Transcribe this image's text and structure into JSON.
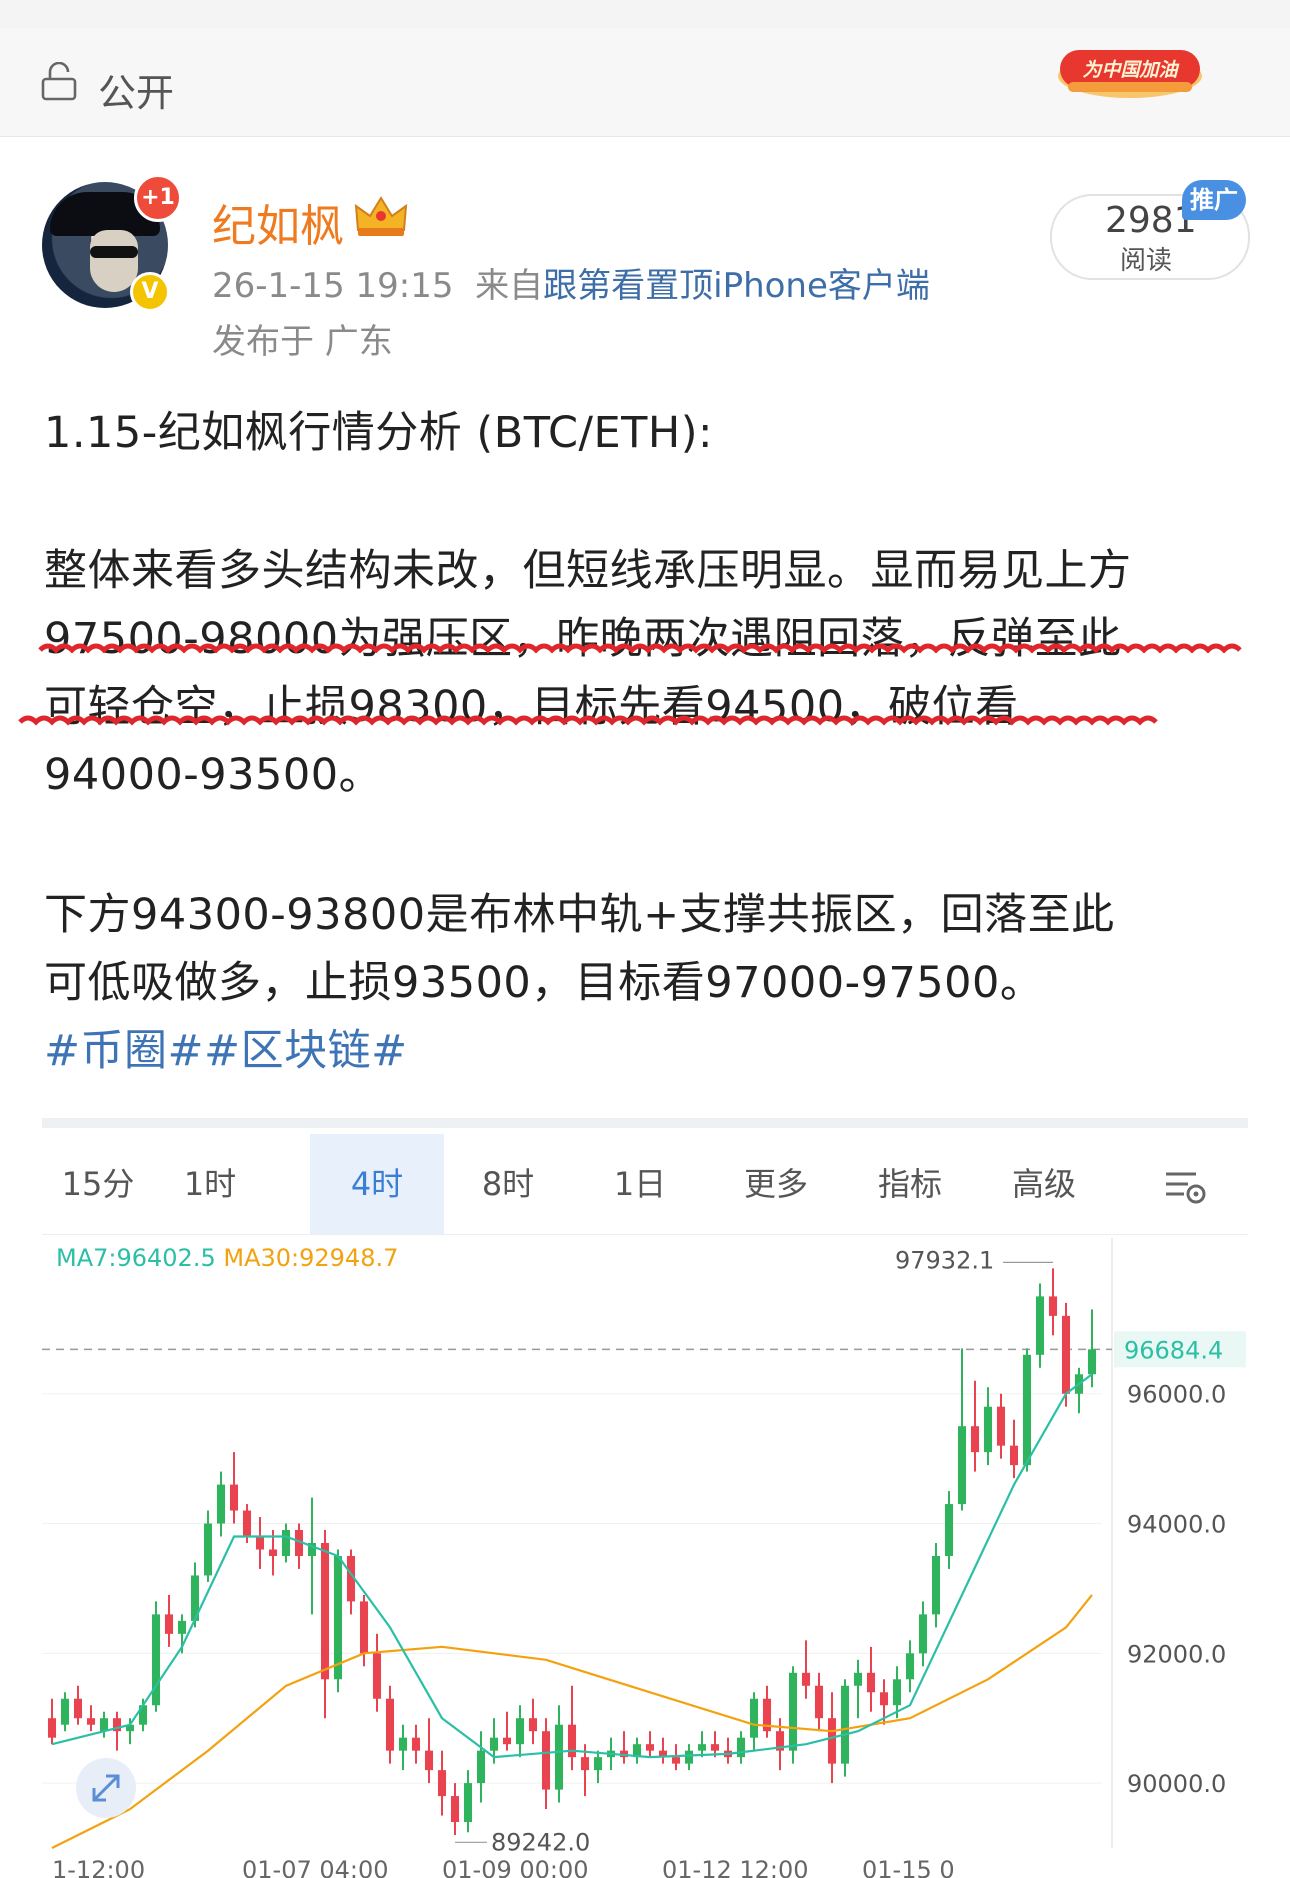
{
  "visibility": {
    "label": "公开",
    "icon": "lock-open-icon"
  },
  "event_badge": {
    "text": "为中国加油"
  },
  "post": {
    "avatar_badge": "+1",
    "verify_badge": "V",
    "username": "纪如枫",
    "time": "26-1-15 19:15",
    "from_prefix": "来自",
    "source": "跟第看置顶iPhone客户端",
    "location": "发布于 广东",
    "reads": "2981",
    "reads_label": "阅读",
    "promo": "推广",
    "title": "1.15-纪如枫行情分析 (BTC/ETH):",
    "p1_l1": "整体来看多头结构未改，但短线承压明显。显而易见上方",
    "p1_l2": "97500-98000为强压区，昨晚两次遇阻回落，反弹至此",
    "p1_l3": "可轻仓空，止损98300，目标先看94500，破位看",
    "p1_l4": "94000-93500。",
    "p2_l1": "下方94300-93800是布林中轨+支撑共振区，回落至此",
    "p2_l2": "可低吸做多，止损93500，目标看97000-97500。",
    "tags": "#币圈##区块链#"
  },
  "chart_tabs": [
    "15分",
    "1时",
    "4时",
    "8时",
    "1日",
    "更多",
    "指标",
    "高级"
  ],
  "chart_active_tab": "4时",
  "indicators": {
    "ma7": "MA7:96402.5",
    "ma30": "MA30:92948.7"
  },
  "chart_data": {
    "type": "candlestick",
    "y_ticks": [
      "96000.0",
      "94000.0",
      "92000.0",
      "90000.0"
    ],
    "ylim": [
      89000,
      98400
    ],
    "last_price": "96684.4",
    "last_price_value": 96684.4,
    "high_label": "97932.1",
    "high_value": 97932.1,
    "low_label": "89242.0",
    "low_value": 89242.0,
    "x_labels": [
      "1-12:00",
      "01-07 04:00",
      "01-09 00:00",
      "01-12 12:00",
      "01-15 0"
    ],
    "colors": {
      "up": "#2fb35c",
      "down": "#e8434f",
      "ma7": "#2bbfa6",
      "ma30": "#f3a20f",
      "last": "#2bbfa6"
    },
    "candles": [
      [
        91000,
        91300,
        90600,
        90700
      ],
      [
        90900,
        91400,
        90800,
        91300
      ],
      [
        91300,
        91500,
        90900,
        91000
      ],
      [
        91000,
        91200,
        90800,
        90900
      ],
      [
        90800,
        91100,
        90700,
        91000
      ],
      [
        91000,
        91100,
        90500,
        90800
      ],
      [
        90800,
        91000,
        90600,
        90900
      ],
      [
        90900,
        91300,
        90800,
        91200
      ],
      [
        91200,
        92800,
        91100,
        92600
      ],
      [
        92600,
        92900,
        92100,
        92300
      ],
      [
        92300,
        92600,
        92000,
        92500
      ],
      [
        92500,
        93400,
        92400,
        93200
      ],
      [
        93200,
        94200,
        93100,
        94000
      ],
      [
        94000,
        94800,
        93800,
        94600
      ],
      [
        94600,
        95100,
        94000,
        94200
      ],
      [
        94200,
        94300,
        93700,
        93800
      ],
      [
        93800,
        94100,
        93300,
        93600
      ],
      [
        93600,
        93900,
        93200,
        93500
      ],
      [
        93500,
        94000,
        93400,
        93900
      ],
      [
        93900,
        94000,
        93300,
        93500
      ],
      [
        93500,
        94400,
        92600,
        93700
      ],
      [
        93700,
        93900,
        91000,
        91600
      ],
      [
        91600,
        93600,
        91400,
        93500
      ],
      [
        93500,
        93600,
        92600,
        92800
      ],
      [
        92800,
        92900,
        91800,
        92000
      ],
      [
        92000,
        92300,
        91100,
        91300
      ],
      [
        91300,
        91500,
        90300,
        90500
      ],
      [
        90500,
        90900,
        90200,
        90700
      ],
      [
        90700,
        90900,
        90300,
        90500
      ],
      [
        90500,
        91000,
        90000,
        90200
      ],
      [
        90200,
        90500,
        89500,
        89800
      ],
      [
        89800,
        90000,
        89200,
        89400
      ],
      [
        89400,
        90200,
        89242,
        90000
      ],
      [
        90000,
        90800,
        89700,
        90500
      ],
      [
        90500,
        91000,
        90300,
        90700
      ],
      [
        90700,
        91100,
        90500,
        90600
      ],
      [
        90600,
        91200,
        90400,
        91000
      ],
      [
        91000,
        91300,
        90600,
        90800
      ],
      [
        90800,
        91000,
        89600,
        89900
      ],
      [
        89900,
        91200,
        89700,
        90900
      ],
      [
        90900,
        91500,
        90200,
        90400
      ],
      [
        90400,
        90600,
        89800,
        90200
      ],
      [
        90200,
        90500,
        90000,
        90400
      ],
      [
        90400,
        90700,
        90200,
        90500
      ],
      [
        90500,
        90800,
        90300,
        90400
      ],
      [
        90400,
        90700,
        90300,
        90600
      ],
      [
        90600,
        90800,
        90400,
        90500
      ],
      [
        90500,
        90700,
        90300,
        90400
      ],
      [
        90400,
        90600,
        90200,
        90300
      ],
      [
        90300,
        90600,
        90200,
        90500
      ],
      [
        90500,
        90800,
        90400,
        90600
      ],
      [
        90600,
        90800,
        90400,
        90500
      ],
      [
        90500,
        90700,
        90300,
        90400
      ],
      [
        90400,
        90800,
        90300,
        90700
      ],
      [
        90700,
        91400,
        90500,
        91300
      ],
      [
        91300,
        91500,
        90700,
        90800
      ],
      [
        90800,
        91000,
        90200,
        90500
      ],
      [
        90500,
        91800,
        90300,
        91700
      ],
      [
        91700,
        92200,
        91300,
        91500
      ],
      [
        91500,
        91700,
        90800,
        91000
      ],
      [
        91000,
        91400,
        90000,
        90300
      ],
      [
        90300,
        91600,
        90100,
        91500
      ],
      [
        91500,
        91900,
        91000,
        91700
      ],
      [
        91700,
        92100,
        91100,
        91400
      ],
      [
        91400,
        91600,
        90900,
        91200
      ],
      [
        91200,
        91800,
        91000,
        91600
      ],
      [
        91600,
        92200,
        91400,
        92000
      ],
      [
        92000,
        92800,
        91800,
        92600
      ],
      [
        92600,
        93700,
        92400,
        93500
      ],
      [
        93500,
        94500,
        93300,
        94300
      ],
      [
        94300,
        96700,
        94200,
        95500
      ],
      [
        95500,
        96200,
        94800,
        95100
      ],
      [
        95100,
        96100,
        94900,
        95800
      ],
      [
        95800,
        96000,
        95000,
        95200
      ],
      [
        95200,
        95600,
        94700,
        94900
      ],
      [
        94900,
        96700,
        94800,
        96600
      ],
      [
        96600,
        97700,
        96400,
        97500
      ],
      [
        97500,
        97932,
        96900,
        97200
      ],
      [
        97200,
        97400,
        95800,
        96000
      ],
      [
        96000,
        96400,
        95700,
        96300
      ],
      [
        96300,
        97300,
        96100,
        96684
      ]
    ],
    "ma7": [
      [
        0,
        90600
      ],
      [
        6,
        90900
      ],
      [
        10,
        92100
      ],
      [
        14,
        93800
      ],
      [
        18,
        93800
      ],
      [
        22,
        93500
      ],
      [
        26,
        92400
      ],
      [
        30,
        91000
      ],
      [
        34,
        90400
      ],
      [
        40,
        90500
      ],
      [
        46,
        90400
      ],
      [
        52,
        90450
      ],
      [
        58,
        90600
      ],
      [
        62,
        90800
      ],
      [
        66,
        91200
      ],
      [
        70,
        92900
      ],
      [
        74,
        94600
      ],
      [
        78,
        96000
      ],
      [
        80,
        96300
      ]
    ],
    "ma30": [
      [
        0,
        89000
      ],
      [
        6,
        89600
      ],
      [
        12,
        90500
      ],
      [
        18,
        91500
      ],
      [
        24,
        92000
      ],
      [
        30,
        92100
      ],
      [
        38,
        91900
      ],
      [
        46,
        91400
      ],
      [
        54,
        90900
      ],
      [
        60,
        90800
      ],
      [
        66,
        91000
      ],
      [
        72,
        91600
      ],
      [
        78,
        92400
      ],
      [
        80,
        92900
      ]
    ]
  }
}
